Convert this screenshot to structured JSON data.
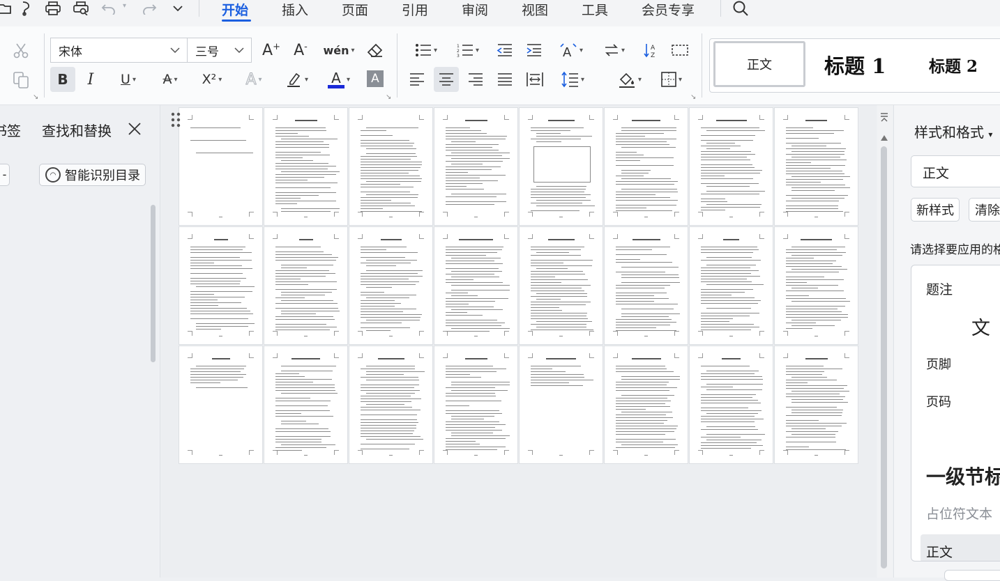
{
  "quick_access": {
    "icons": [
      "open-folder-icon",
      "format-brush-icon",
      "print-icon",
      "print-preview-icon",
      "undo-icon",
      "redo-icon",
      "more-dropdown-icon"
    ]
  },
  "menu": {
    "tabs": [
      "开始",
      "插入",
      "页面",
      "引用",
      "审阅",
      "视图",
      "工具",
      "会员专享"
    ],
    "active": "开始",
    "accent_color": "#1b5fe0"
  },
  "ribbon": {
    "font_name": "宋体",
    "font_size": "三号",
    "bold": "B",
    "italic": "I",
    "underline": "U",
    "strikethrough": "A",
    "superscript": "X²",
    "font_color_letter": "A",
    "font_color": "#1a2ad8",
    "char_shading_letter": "A",
    "grow_font": "A+",
    "shrink_font": "A-",
    "pinyin": "wén"
  },
  "styles_gallery": {
    "normal": "正文",
    "heading1": "标题 1",
    "heading2": "标题 2"
  },
  "left_panel": {
    "tab_bookmark": "书签",
    "tab_find_replace": "查找和替换",
    "smart_toc": "智能识别目录"
  },
  "styles_panel": {
    "title": "样式和格式",
    "current_style": "正文",
    "new_style": "新样式",
    "clear_format": "清除",
    "hint": "请选择要应用的格",
    "items": {
      "caption": "题注",
      "sample_text": "文 字",
      "footer": "页脚",
      "page_number": "页码",
      "heading_level1": "一级节标",
      "placeholder": "占位符文本",
      "normal": "正文"
    }
  }
}
